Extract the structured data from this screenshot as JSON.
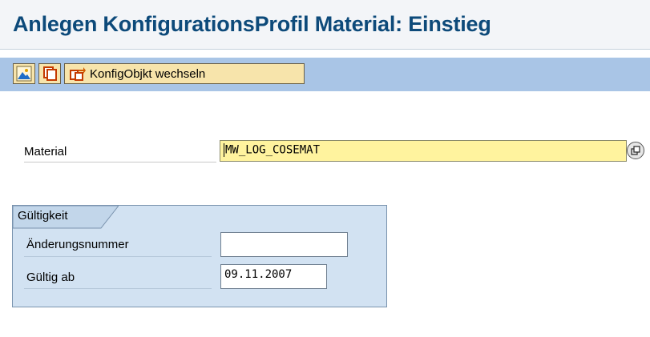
{
  "header": {
    "title": "Anlegen KonfigurationsProfil Material: Einstieg"
  },
  "toolbar": {
    "buttons": [
      {
        "icon": "mountain-picture-icon"
      },
      {
        "icon": "copy-windows-icon"
      },
      {
        "icon": "switch-object-icon",
        "label": "KonfigObjkt wechseln"
      }
    ]
  },
  "form": {
    "material": {
      "label": "Material",
      "value": "MW_LOG_COSEMAT"
    },
    "validity": {
      "group_title": "Gültigkeit",
      "change_number": {
        "label": "Änderungsnummer",
        "value": ""
      },
      "valid_from": {
        "label": "Gültig ab",
        "value": "09.11.2007"
      }
    }
  },
  "colors": {
    "title": "#0d4a7a",
    "toolbar_bg": "#a9c5e6",
    "button_bg": "#f7e4ab",
    "required_field_bg": "#fff39e",
    "group_bg": "#d2e2f2"
  }
}
